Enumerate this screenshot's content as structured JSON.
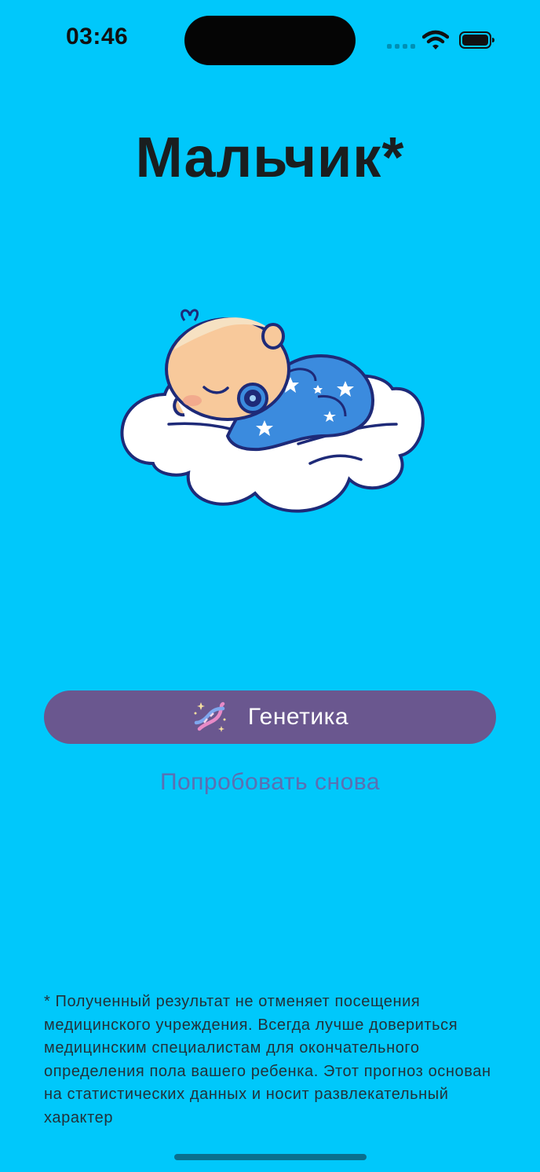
{
  "status_bar": {
    "time": "03:46"
  },
  "result": {
    "title": "Мальчик*",
    "illustration_icon": "sleeping-baby-on-cloud-icon"
  },
  "actions": {
    "genetics_label": "Генетика",
    "genetics_icon": "dna-icon",
    "retry_label": "Попробовать снова"
  },
  "disclaimer": {
    "text": "* Полученный результат не отменяет посещения медицинского учреждения. Всегда лучше довериться медицинским специалистам для окончательного определения пола вашего ребенка. Этот прогноз основан на статистических данных и носит развлекательный характер"
  },
  "colors": {
    "background": "#00c8fb",
    "button": "#6a578f",
    "link": "#5b6fb2",
    "title": "#1a1e1f"
  }
}
